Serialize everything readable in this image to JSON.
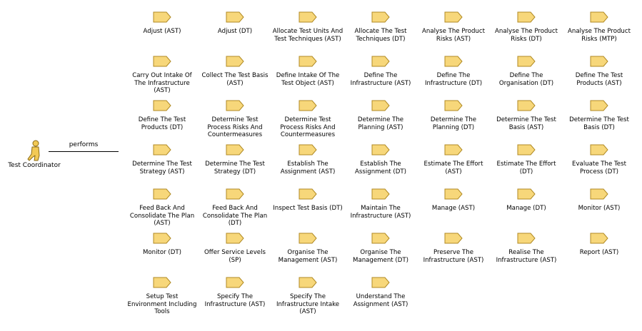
{
  "actor": {
    "name": "Test Coordinator"
  },
  "association": {
    "label": "performs"
  },
  "colors": {
    "process_fill": "#f7d77a",
    "process_stroke": "#b08a24",
    "actor_fill": "#f2c955",
    "actor_stroke": "#8a6a14"
  },
  "processes": [
    [
      "Adjust (AST)",
      "Adjust (DT)",
      "Allocate Test Units And Test Techniques (AST)",
      "Allocate The Test Techniques (DT)",
      "Analyse The Product Risks (AST)",
      "Analyse The Product Risks (DT)",
      "Analyse The Product Risks (MTP)"
    ],
    [
      "Carry Out Intake Of The Infrastructure (AST)",
      "Collect The Test Basis (AST)",
      "Define Intake Of The Test Object (AST)",
      "Define The Infrastructure (AST)",
      "Define The Infrastructure (DT)",
      "Define The Organisation (DT)",
      "Define The Test Products (AST)"
    ],
    [
      "Define The Test Products (DT)",
      "Determine Test Process Risks And Countermeasures",
      "Determine Test Process Risks And Countermeasures",
      "Determine The Planning (AST)",
      "Determine The Planning (DT)",
      "Determine The Test Basis (AST)",
      "Determine The Test Basis (DT)"
    ],
    [
      "Determine The Test Strategy (AST)",
      "Determine The Test Strategy (DT)",
      "Establish The Assignment (AST)",
      "Establish The Assignment (DT)",
      "Estimate The Effort (AST)",
      "Estimate The Effort (DT)",
      "Evaluate The Test Process (DT)"
    ],
    [
      "Feed Back And Consolidate The Plan (AST)",
      "Feed Back And Consolidate The Plan (DT)",
      "Inspect Test Basis (DT)",
      "Maintain The Infrastructure (AST)",
      "Manage (AST)",
      "Manage (DT)",
      "Monitor (AST)"
    ],
    [
      "Monitor (DT)",
      "Offer Service Levels (SP)",
      "Organise The Management (AST)",
      "Organise The Management (DT)",
      "Preserve The Infrastructure (AST)",
      "Realise The Infrastructure (AST)",
      "Report (AST)"
    ],
    [
      "Setup Test Environment Including Tools",
      "Specify The Infrastructure (AST)",
      "Specify The Infrastructure Intake (AST)",
      "Understand The Assignment (AST)"
    ]
  ]
}
